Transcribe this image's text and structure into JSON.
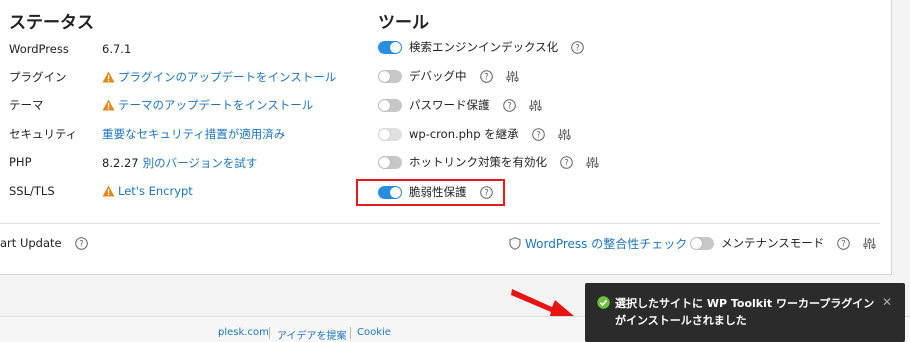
{
  "status": {
    "heading": "ステータス",
    "rows": [
      {
        "label": "WordPress",
        "value": "6.7.1"
      },
      {
        "label": "プラグイン",
        "value": "プラグインのアップデートをインストール"
      },
      {
        "label": "テーマ",
        "value": "テーマのアップデートをインストール"
      },
      {
        "label": "セキュリティ",
        "value": "重要なセキュリティ措置が適用済み"
      },
      {
        "label": "PHP",
        "version": "8.2.27",
        "link": "別のバージョンを試す"
      },
      {
        "label": "SSL/TLS",
        "value": "Let's Encrypt"
      }
    ]
  },
  "tools": {
    "heading": "ツール",
    "items": [
      {
        "label": "検索エンジンインデックス化",
        "enabled": true
      },
      {
        "label": "デバッグ中",
        "enabled": false
      },
      {
        "label": "パスワード保護",
        "enabled": false
      },
      {
        "label": "wp-cron.php を継承",
        "enabled": false
      },
      {
        "label": "ホットリンク対策を有効化",
        "enabled": false
      },
      {
        "label": "脆弱性保護",
        "enabled": true
      }
    ]
  },
  "bottom": {
    "smart_update": "art Update",
    "integrity_check": "WordPress の整合性チェック",
    "maintenance_mode": "メンテナンスモード"
  },
  "footer": {
    "links": [
      "plesk.com",
      "アイデアを提案",
      "Cookie"
    ]
  },
  "toast": {
    "message": "選択したサイトに WP Toolkit ワーカープラグインがインストールされました",
    "close": "✕"
  },
  "colors": {
    "accent": "#2a8ee0",
    "link": "#1f75b7",
    "warning": "#e0891b",
    "highlight": "#e01e1e",
    "success": "#6fbf3f"
  }
}
